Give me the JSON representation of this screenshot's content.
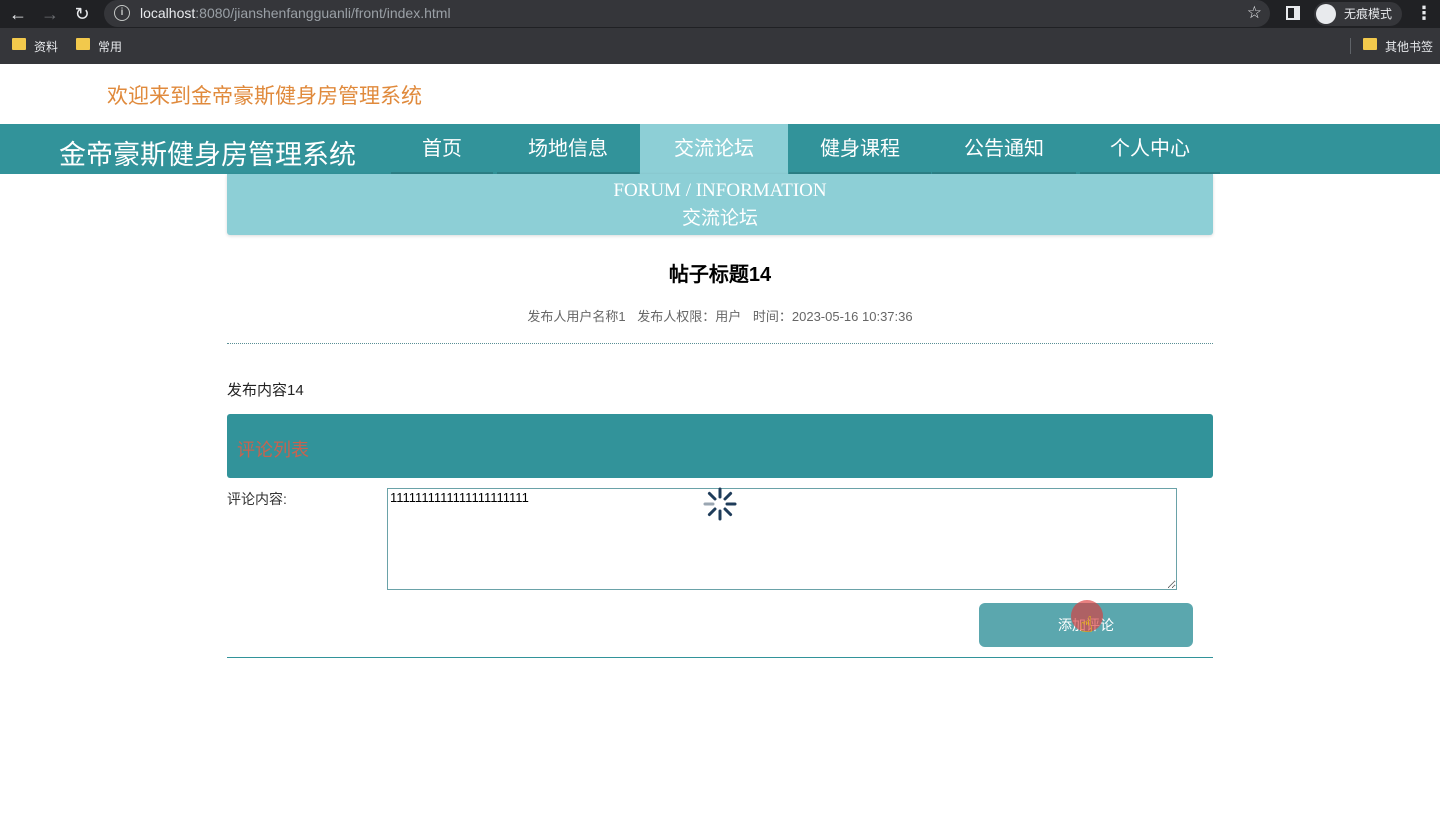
{
  "browser": {
    "url_host": "localhost",
    "url_rest": ":8080/jianshenfangguanli/front/index.html",
    "incognito_label": "无痕模式",
    "bookmarks": [
      "资料",
      "常用"
    ],
    "other_bookmarks": "其他书签"
  },
  "page": {
    "welcome": "欢迎来到金帝豪斯健身房管理系统",
    "brand": "金帝豪斯健身房管理系统",
    "nav": [
      "首页",
      "场地信息",
      "交流论坛",
      "健身课程",
      "公告通知",
      "个人中心"
    ],
    "active_nav": "交流论坛",
    "banner_en": "FORUM / INFORMATION",
    "banner_cn": "交流论坛"
  },
  "post": {
    "title": "帖子标题14",
    "author": "发布人用户名称1",
    "role": "发布人权限：用户",
    "time": "时间：2023-05-16 10:37:36",
    "content": "发布内容14"
  },
  "comments": {
    "header": "评论列表",
    "label": "评论内容:",
    "input_value": "1111111111111111111111",
    "submit_label": "添加评论"
  },
  "colors": {
    "primary": "#32939a",
    "primary_light": "#8dcfd6",
    "welcome": "#e08a3c",
    "comment_header_text": "#c7634f",
    "button": "#5ba7ae"
  }
}
